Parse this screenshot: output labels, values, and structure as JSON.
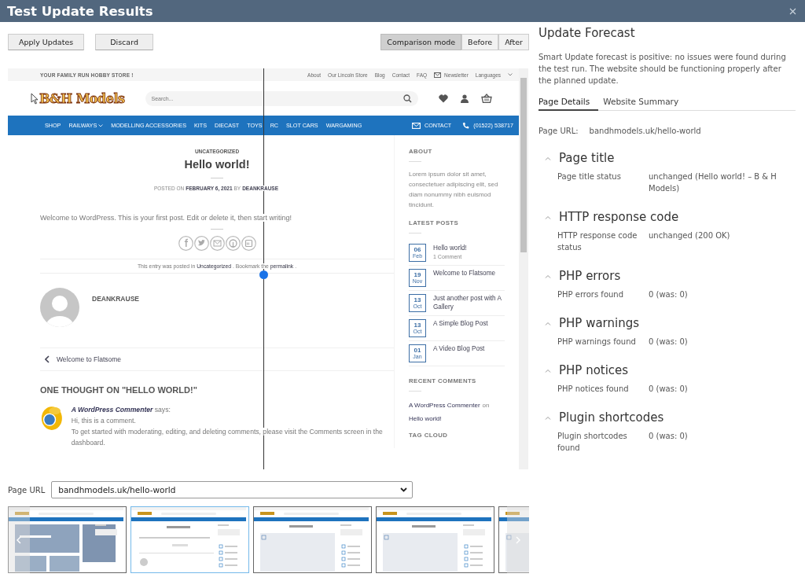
{
  "window": {
    "title": "Test Update Results"
  },
  "actions": [
    {
      "label": "Apply Updates"
    },
    {
      "label": "Discard"
    }
  ],
  "view_modes": [
    {
      "label": "Comparison mode",
      "selected": true
    },
    {
      "label": "Before",
      "selected": false
    },
    {
      "label": "After",
      "selected": false
    }
  ],
  "preview": {
    "top_bar": {
      "tagline": "YOUR FAMILY RUN HOBBY STORE !",
      "links": [
        {
          "label": "About",
          "kind": "plain"
        },
        {
          "label": "Our Lincoln Store",
          "kind": "plain"
        },
        {
          "label": "Blog",
          "kind": "plain"
        },
        {
          "label": "Contact",
          "kind": "plain"
        },
        {
          "label": "FAQ",
          "kind": "plain"
        },
        {
          "label": "Newsletter",
          "kind": "mail"
        },
        {
          "label": "Languages",
          "kind": "dropdown"
        }
      ]
    },
    "header": {
      "logo": "B&H Models",
      "search_placeholder": "Search..."
    },
    "nav": {
      "items": [
        {
          "label": "SHOP",
          "dropdown": false
        },
        {
          "label": "RAILWAYS",
          "dropdown": true
        },
        {
          "label": "MODELLING ACCESSORIES",
          "dropdown": false
        },
        {
          "label": "KITS",
          "dropdown": false
        },
        {
          "label": "DIECAST",
          "dropdown": false
        },
        {
          "label": "TOYS",
          "dropdown": false
        },
        {
          "label": "RC",
          "dropdown": false
        },
        {
          "label": "SLOT CARS",
          "dropdown": false
        },
        {
          "label": "WARGAMING",
          "dropdown": false
        }
      ],
      "contact": "CONTACT",
      "phone": "(01522) 538717"
    },
    "post": {
      "category": "UNCATEGORIZED",
      "title": "Hello world!",
      "meta": [
        {
          "text": "POSTED ON",
          "kind": "plain"
        },
        {
          "text": "FEBRUARY 6, 2021",
          "kind": "link"
        },
        {
          "text": "BY",
          "kind": "plain"
        },
        {
          "text": "DEANKRAUSE",
          "kind": "link"
        }
      ],
      "body": "Welcome to WordPress. This is your first post. Edit or delete it, then start writing!",
      "footer": [
        {
          "text": "This entry was posted in",
          "kind": "plain"
        },
        {
          "text": "Uncategorized",
          "kind": "link"
        },
        {
          "text": ". Bookmark the",
          "kind": "plain"
        },
        {
          "text": "permalink",
          "kind": "link"
        },
        {
          "text": ".",
          "kind": "plain"
        }
      ],
      "author": "DEANKRAUSE",
      "previous_post": "Welcome to Flatsome",
      "comments_heading": "ONE THOUGHT ON \"HELLO WORLD!\"",
      "comment": {
        "author": "A WordPress Commenter",
        "says": "says:",
        "lines": [
          "Hi, this is a comment.",
          "To get started with moderating, editing, and deleting comments, please visit the Comments screen in the dashboard."
        ]
      }
    },
    "sidebar": {
      "about_heading": "ABOUT",
      "about_text": "Lorem ipsum dolor sit amet, consectetuer adipiscing elit, sed diam nonummy nibh euismod tincidunt.",
      "latest_heading": "LATEST POSTS",
      "latest_posts": [
        {
          "day": "06",
          "month": "Feb",
          "title": "Hello world!",
          "comments": "1 Comment"
        },
        {
          "day": "19",
          "month": "Nov",
          "title": "Welcome to Flatsome"
        },
        {
          "day": "13",
          "month": "Oct",
          "title": "Just another post with A Gallery"
        },
        {
          "day": "13",
          "month": "Oct",
          "title": "A Simple Blog Post"
        },
        {
          "day": "01",
          "month": "Jan",
          "title": "A Video Blog Post"
        }
      ],
      "recent_heading": "RECENT COMMENTS",
      "recent_comment": [
        {
          "text": "A WordPress Commenter",
          "kind": "link"
        },
        {
          "text": "on",
          "kind": "plain"
        },
        {
          "text": "Hello world!",
          "kind": "link"
        }
      ],
      "tag_heading": "TAG CLOUD"
    }
  },
  "page_select": {
    "label": "Page URL",
    "value": "bandhmodels.uk/hello-world"
  },
  "thumbnails": [
    {
      "kind": "featured",
      "selected": false
    },
    {
      "kind": "post",
      "selected": true
    },
    {
      "kind": "media",
      "selected": false
    },
    {
      "kind": "media",
      "selected": false
    },
    {
      "kind": "media",
      "selected": false
    }
  ],
  "forecast": {
    "title": "Update Forecast",
    "summary": "Smart Update forecast is positive: no issues were found during the test run. The website should be functioning properly after the planned update.",
    "tabs": [
      {
        "label": "Page Details",
        "selected": true
      },
      {
        "label": "Website Summary",
        "selected": false
      }
    ],
    "page_url_label": "Page URL:",
    "page_url": "bandhmodels.uk/hello-world",
    "sections": [
      {
        "title": "Page title",
        "expanded": true,
        "rows": [
          {
            "label": "Page title status",
            "value": "unchanged (Hello world! – B & H Models)"
          }
        ]
      },
      {
        "title": "HTTP response code",
        "expanded": true,
        "rows": [
          {
            "label": "HTTP response code status",
            "value": "unchanged (200 OK)"
          }
        ]
      },
      {
        "title": "PHP errors",
        "expanded": true,
        "rows": [
          {
            "label": "PHP errors found",
            "value": "0 (was: 0)"
          }
        ]
      },
      {
        "title": "PHP warnings",
        "expanded": true,
        "rows": [
          {
            "label": "PHP warnings found",
            "value": "0 (was: 0)"
          }
        ]
      },
      {
        "title": "PHP notices",
        "expanded": true,
        "rows": [
          {
            "label": "PHP notices found",
            "value": "0 (was: 0)"
          }
        ]
      },
      {
        "title": "Plugin shortcodes",
        "expanded": true,
        "rows": [
          {
            "label": "Plugin shortcodes found",
            "value": "0 (was: 0)"
          }
        ]
      }
    ]
  }
}
